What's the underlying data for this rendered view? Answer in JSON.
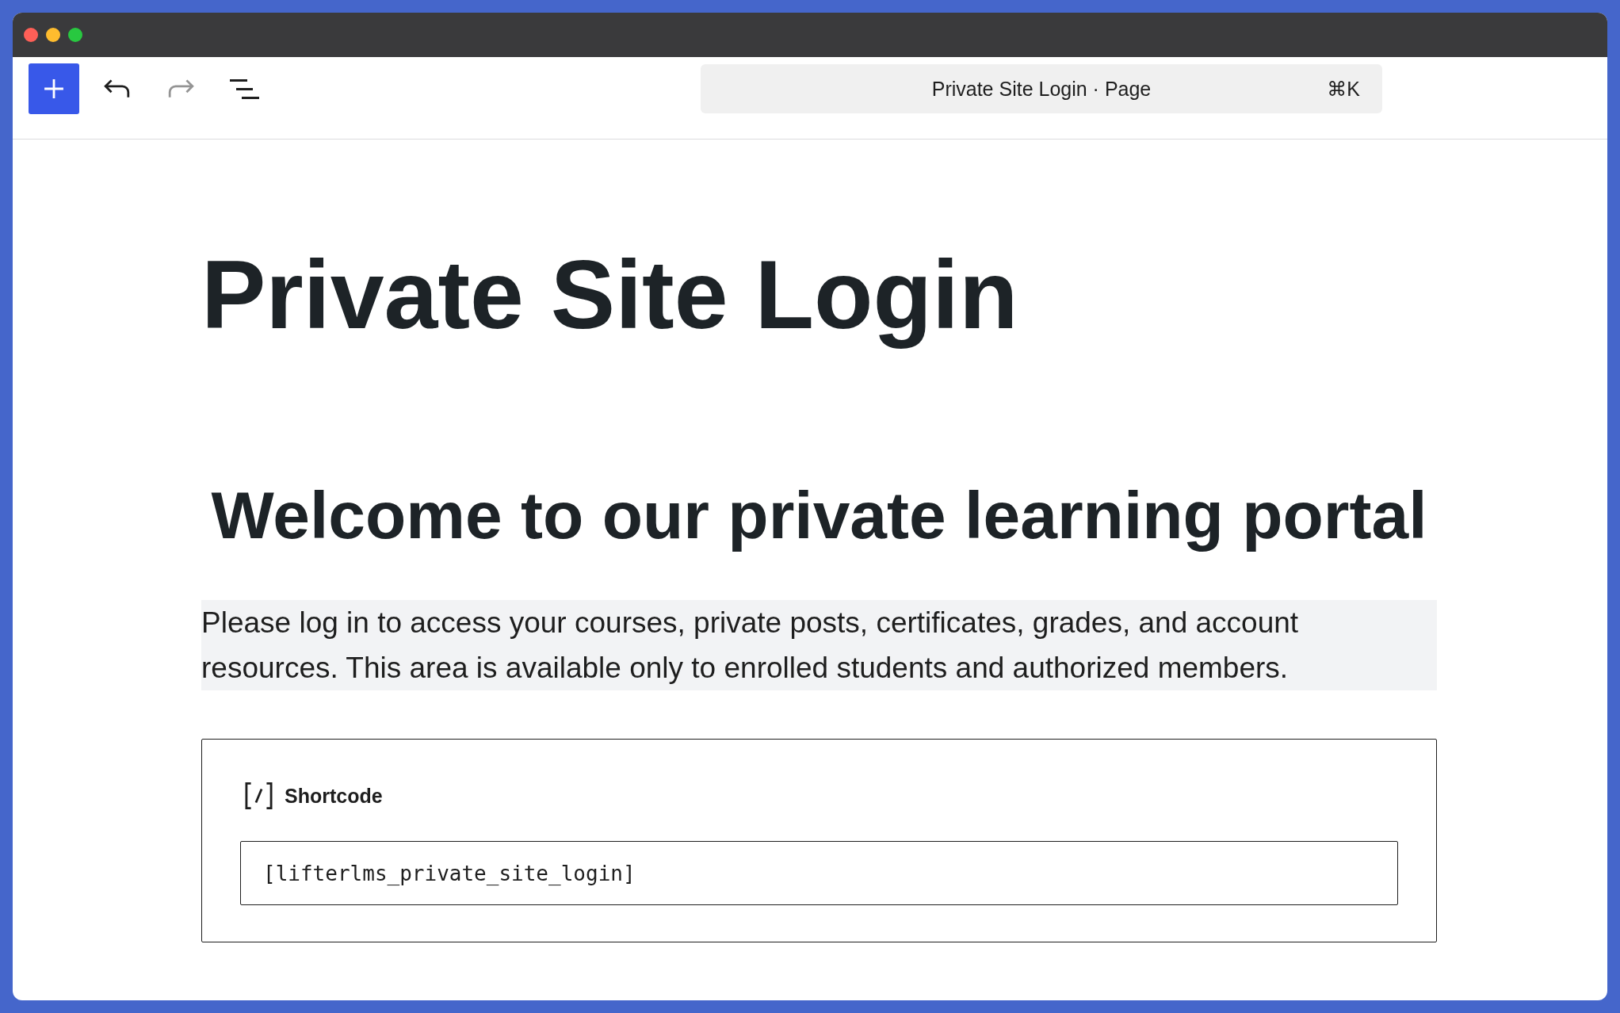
{
  "toolbar": {
    "buttons": [
      {
        "kind": "inserter",
        "disabled": false
      },
      {
        "kind": "undo",
        "disabled": false
      },
      {
        "kind": "redo",
        "disabled": true
      },
      {
        "kind": "list_view",
        "disabled": false
      }
    ],
    "command_bar": {
      "title": "Private Site Login · Page",
      "shortcut": "⌘K"
    }
  },
  "page": {
    "title": "Private Site Login",
    "heading": "Welcome to our private learning portal",
    "paragraph": "Please log in to access your courses, private posts, certificates, grades, and account resources. This area is available only to enrolled students and authorized members.",
    "shortcode_block": {
      "label": "Shortcode",
      "value": "[lifterlms_private_site_login]"
    }
  }
}
